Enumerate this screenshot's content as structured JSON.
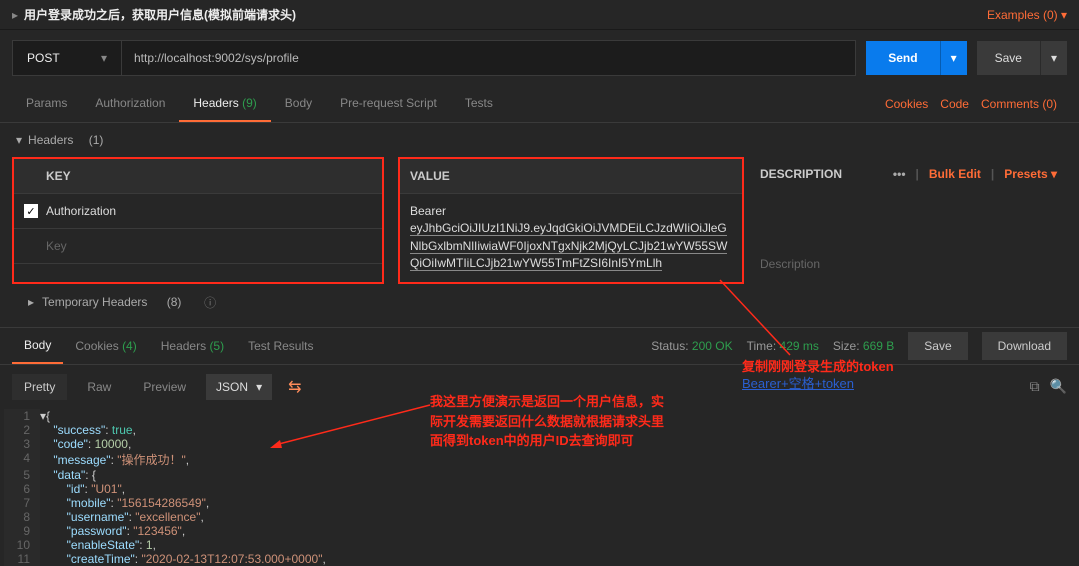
{
  "titlebar": {
    "title": "用户登录成功之后，获取用户信息(模拟前端请求头)",
    "examples": "Examples (0)"
  },
  "request": {
    "method": "POST",
    "url": "http://localhost:9002/sys/profile",
    "send": "Send",
    "save": "Save"
  },
  "tabs": {
    "params": "Params",
    "auth": "Authorization",
    "headers": "Headers",
    "headers_count": "(9)",
    "body": "Body",
    "prereq": "Pre-request Script",
    "tests": "Tests",
    "cookies": "Cookies",
    "code": "Code",
    "comments": "Comments (0)"
  },
  "headers_section": {
    "title": "Headers",
    "count": "(1)",
    "key_label": "KEY",
    "value_label": "VALUE",
    "desc_label": "DESCRIPTION",
    "bulk": "Bulk Edit",
    "presets": "Presets",
    "row_key": "Authorization",
    "row_key_ph": "Key",
    "row_val_prefix": "Bearer",
    "row_val_token": "eyJhbGciOiJIUzI1NiJ9.eyJqdGkiOiJVMDEiLCJzdWIiOiJleGNlbGxlbmNlIiwiaWF0IjoxNTgxNjk2MjQyLCJjb21wYW55SWQiOiIwMTIiLCJjb21wYW55TmFtZSI6InI5YmLlh",
    "desc_ph": "Description",
    "temp": "Temporary Headers",
    "temp_count": "(8)"
  },
  "response": {
    "tabs": {
      "body": "Body",
      "cookies": "Cookies",
      "cookies_cnt": "(4)",
      "headers": "Headers",
      "headers_cnt": "(5)",
      "tests": "Test Results"
    },
    "status_label": "Status:",
    "status_value": "200 OK",
    "time_label": "Time:",
    "time_value": "429 ms",
    "size_label": "Size:",
    "size_value": "669 B",
    "save": "Save",
    "download": "Download",
    "view": {
      "pretty": "Pretty",
      "raw": "Raw",
      "preview": "Preview",
      "fmt": "JSON"
    }
  },
  "json_body": {
    "success": true,
    "code": 10000,
    "message": "操作成功！",
    "data": {
      "id": "U01",
      "mobile": "156154286549",
      "username": "excellence",
      "password": "123456",
      "enableState": 1,
      "createTime": "2020-02-13T12:07:53.000+0000"
    }
  },
  "annotations": {
    "a1_l1": "我这里方便演示是返回一个用户信息，实",
    "a1_l2": "际开发需要返回什么数据就根据请求头里",
    "a1_l3": "面得到token中的用户ID去查询即可",
    "a2": "复制刚刚登录生成的token",
    "a2b": "Bearer+空格+token"
  }
}
